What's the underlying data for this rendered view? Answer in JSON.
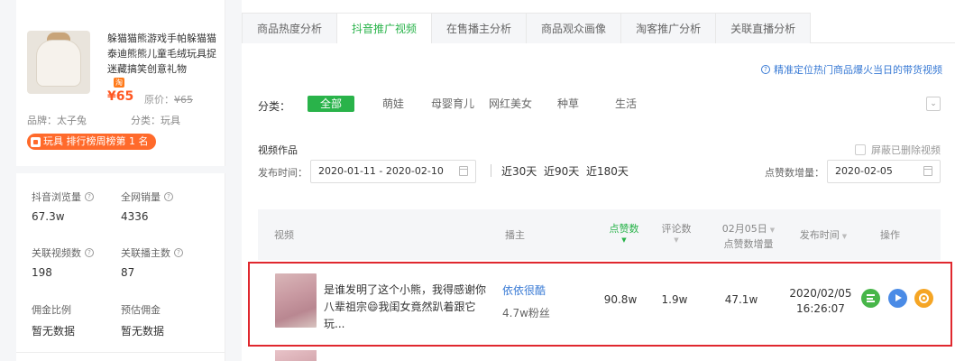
{
  "product": {
    "title": "躲猫猫熊游戏手帕躲猫猫泰迪熊熊儿童毛绒玩具捉迷藏搞笑创意礼物",
    "tb_badge": "淘",
    "price": "¥65",
    "orig_price_label": "原价：",
    "orig_price": "¥65",
    "brand": "品牌：太子兔",
    "category": "分类：玩具",
    "rank_badge": "玩具 排行榜周榜第 1 名"
  },
  "stats": [
    {
      "label": "抖音浏览量",
      "value": "67.3w"
    },
    {
      "label": "全网销量",
      "value": "4336"
    },
    {
      "label": "关联视频数",
      "value": "198"
    },
    {
      "label": "关联播主数",
      "value": "87"
    },
    {
      "label": "佣金比例",
      "value": "暂无数据"
    },
    {
      "label": "预估佣金",
      "value": "暂无数据"
    }
  ],
  "tabs": [
    "商品热度分析",
    "抖音推广视频",
    "在售播主分析",
    "商品观众画像",
    "淘客推广分析",
    "关联直播分析"
  ],
  "active_tab": 1,
  "help_link": "精准定位热门商品爆火当日的带货视频",
  "filter": {
    "label": "分类：",
    "categories": [
      "全部",
      "萌娃",
      "母婴育儿",
      "网红美女",
      "种草",
      "生活"
    ]
  },
  "section": {
    "title": "视频作品",
    "hide_deleted": "屏蔽已删除视频",
    "date_label": "发布时间：",
    "date_range": "2020-01-11 - 2020-02-10",
    "quick_ranges": [
      "近30天",
      "近90天",
      "近180天"
    ],
    "likes_label": "点赞数增量：",
    "likes_date": "2020-02-05"
  },
  "table": {
    "headers": {
      "video": "视频",
      "anchor": "播主",
      "likes": "点赞数",
      "comments": "评论数",
      "delta_line1": "02月05日",
      "delta_line2": "点赞数增量",
      "publish": "发布时间",
      "ops": "操作"
    },
    "rows": [
      {
        "title": "是谁发明了这个小熊，我得感谢你八辈祖宗😄我闺女竟然趴着跟它玩...",
        "anchor": "依依很酷",
        "fans": "4.7w粉丝",
        "likes": "90.8w",
        "comments": "1.9w",
        "delta": "47.1w",
        "date": "2020/02/05",
        "time": "16:26:07"
      }
    ]
  },
  "colors": {
    "accent_green": "#29b34a",
    "link_blue": "#3a7bd5",
    "price_orange": "#ff5722",
    "highlight_red": "#e0282e"
  }
}
